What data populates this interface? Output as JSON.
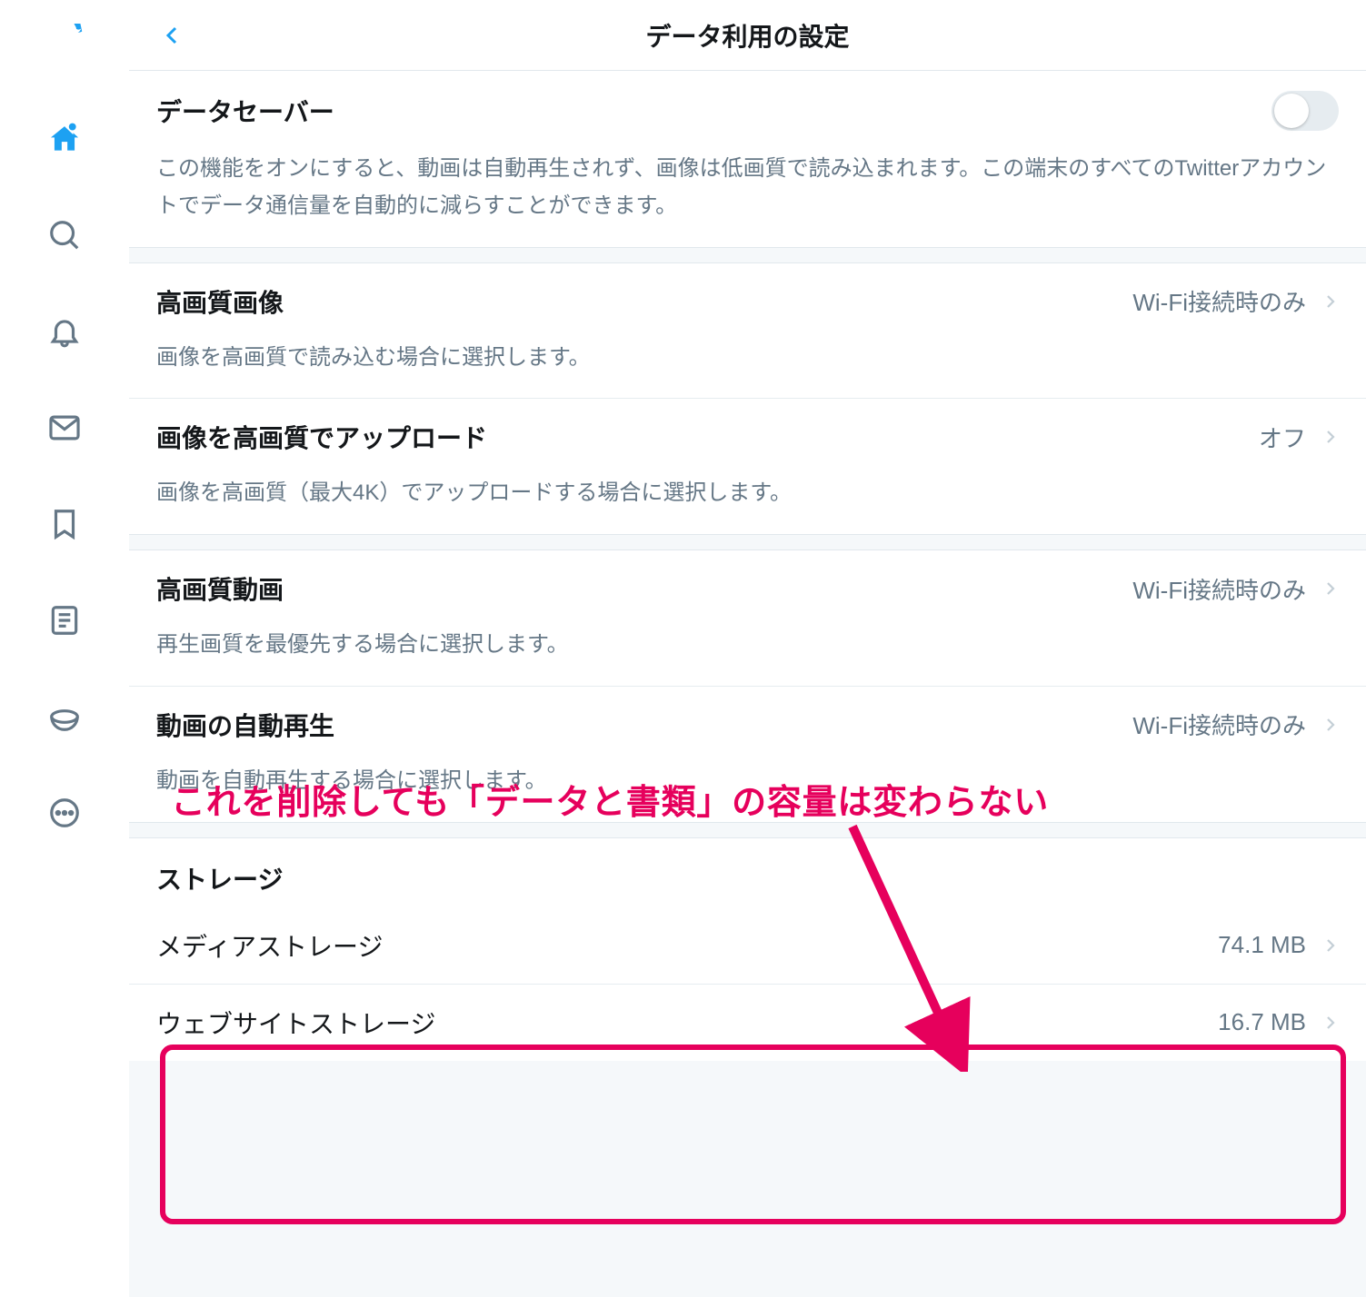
{
  "colors": {
    "accent": "#1DA1F2",
    "annotation": "#e6005c"
  },
  "header": {
    "title": "データ利用の設定"
  },
  "dataSaver": {
    "title": "データセーバー",
    "description": "この機能をオンにすると、動画は自動再生されず、画像は低画質で読み込まれます。この端末のすべてのTwitterアカウントでデータ通信量を自動的に減らすことができます。",
    "enabled": false
  },
  "highQualityImage": {
    "title": "高画質画像",
    "value": "Wi-Fi接続時のみ",
    "description": "画像を高画質で読み込む場合に選択します。"
  },
  "uploadHighQualityImage": {
    "title": "画像を高画質でアップロード",
    "value": "オフ",
    "description": "画像を高画質（最大4K）でアップロードする場合に選択します。"
  },
  "highQualityVideo": {
    "title": "高画質動画",
    "value": "Wi-Fi接続時のみ",
    "description": "再生画質を最優先する場合に選択します。"
  },
  "autoplayVideo": {
    "title": "動画の自動再生",
    "value": "Wi-Fi接続時のみ",
    "description": "動画を自動再生する場合に選択します。"
  },
  "storage": {
    "header": "ストレージ",
    "media": {
      "title": "メディアストレージ",
      "value": "74.1 MB"
    },
    "website": {
      "title": "ウェブサイトストレージ",
      "value": "16.7 MB"
    }
  },
  "annotation": {
    "text": "これを削除しても「データと書類」の容量は変わらない"
  }
}
